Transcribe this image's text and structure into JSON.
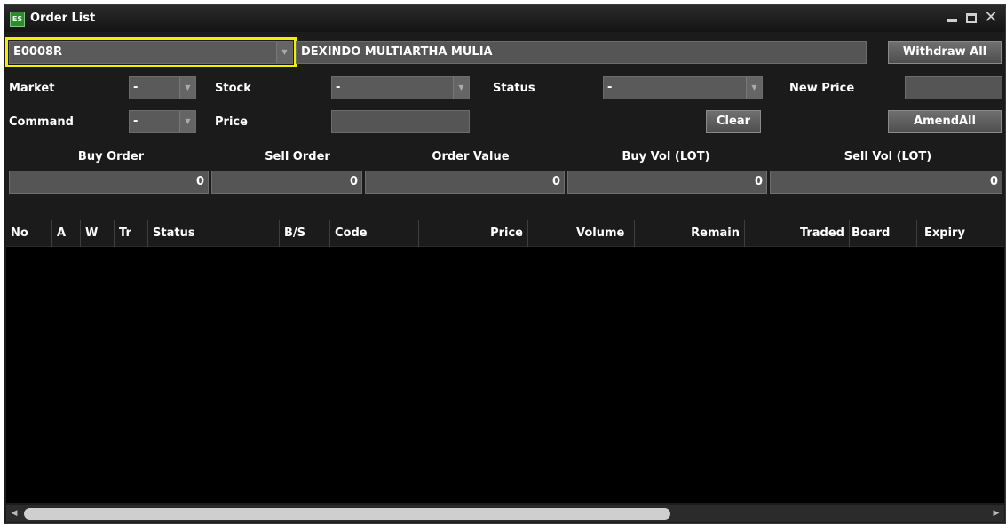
{
  "window": {
    "title": "Order List",
    "icon": "ES"
  },
  "account": {
    "code": "E0008R",
    "name": "DEXINDO MULTIARTHA MULIA"
  },
  "buttons": {
    "withdraw_all": "Withdraw All",
    "clear": "Clear",
    "amend_all": "AmendAll"
  },
  "filters": {
    "market_label": "Market",
    "market_value": "-",
    "stock_label": "Stock",
    "stock_value": "-",
    "status_label": "Status",
    "status_value": "-",
    "new_price_label": "New Price",
    "new_price_value": "",
    "command_label": "Command",
    "command_value": "-",
    "price_label": "Price",
    "price_value": ""
  },
  "summary": {
    "headers": [
      "Buy Order",
      "Sell Order",
      "Order Value",
      "Buy Vol (LOT)",
      "Sell Vol (LOT)"
    ],
    "values": [
      "0",
      "0",
      "0",
      "0",
      "0"
    ]
  },
  "table": {
    "columns": [
      "No",
      "A",
      "W",
      "Tr",
      "Status",
      "B/S",
      "Code",
      "Price",
      "Volume",
      "Remain",
      "Traded",
      "Board",
      "Expiry"
    ],
    "rows": []
  },
  "icons": {
    "app": "order-list-app-icon",
    "minimize": "minimize-icon",
    "maximize": "maximize-icon",
    "close": "close-icon",
    "dropdown": "chevron-down-icon",
    "scroll_left": "scroll-left-arrow-icon",
    "scroll_right": "scroll-right-arrow-icon"
  },
  "colors": {
    "background": "#1b1b1b",
    "field": "#555555",
    "grid": "#000000",
    "highlight": "#f0f000",
    "text": "#ffffff"
  }
}
